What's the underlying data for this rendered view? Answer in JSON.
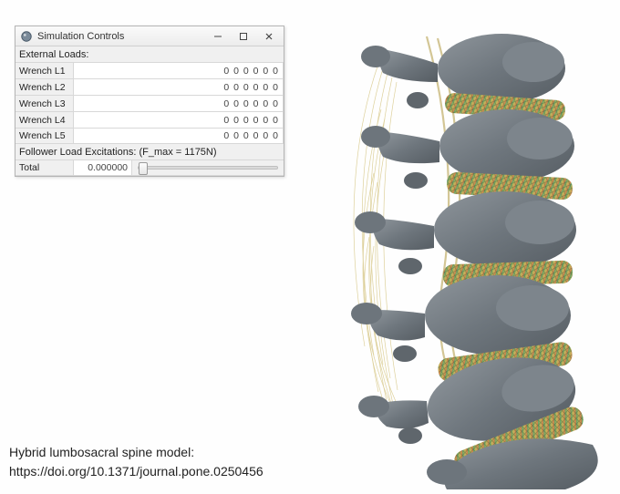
{
  "window": {
    "title": "Simulation Controls",
    "buttons": {
      "min": "–",
      "max": "☐",
      "close": "✕"
    }
  },
  "external_loads": {
    "label": "External Loads:",
    "rows": [
      {
        "label": "Wrench L1",
        "value": "0 0 0 0 0 0"
      },
      {
        "label": "Wrench L2",
        "value": "0 0 0 0 0 0"
      },
      {
        "label": "Wrench L3",
        "value": "0 0 0 0 0 0"
      },
      {
        "label": "Wrench L4",
        "value": "0 0 0 0 0 0"
      },
      {
        "label": "Wrench L5",
        "value": "0 0 0 0 0 0"
      }
    ]
  },
  "follower": {
    "label": "Follower Load Excitations: (F_max = 1175N)",
    "row_label": "Total",
    "value": "0.000000"
  },
  "caption": {
    "line1": "Hybrid lumbosacral spine model:",
    "line2": "https://doi.org/10.1371/journal.pone.0250456"
  }
}
